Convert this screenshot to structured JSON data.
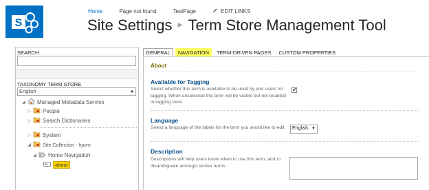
{
  "header": {
    "nav": [
      {
        "label": "Home",
        "active": true
      },
      {
        "label": "Page not found",
        "active": false
      },
      {
        "label": "TestPage",
        "active": false
      }
    ],
    "edit_links": "EDIT LINKS",
    "title_part1": "Site Settings",
    "title_separator": "▸",
    "title_part2": "Term Store Management Tool"
  },
  "left": {
    "search_label": "SEARCH",
    "search_value": "",
    "store_label": "TAXONOMY TERM STORE",
    "store_language": "English",
    "tree": {
      "root": "Managed Metadata Service",
      "people": "People",
      "search_dictionaries": "Search Dictionaries",
      "system": "System",
      "site_collection": "Site Collection - hpvm",
      "home_navigation": "Home Navigation",
      "about": "about"
    }
  },
  "tabs": [
    {
      "label": "GENERAL",
      "current": true,
      "highlight": false
    },
    {
      "label": "NAVIGATION",
      "current": false,
      "highlight": true
    },
    {
      "label": "TERM-DRIVEN PAGES",
      "current": false,
      "highlight": false
    },
    {
      "label": "CUSTOM PROPERTIES",
      "current": false,
      "highlight": false
    }
  ],
  "main": {
    "term_name": "About",
    "tagging_heading": "Available for Tagging",
    "tagging_desc": "Select whether this term is available to be used by end users for tagging. When unselected this term will be visible but not enabled in tagging tools.",
    "tagging_checked": true,
    "language_heading": "Language",
    "language_desc": "Select a language of the labels for the term you would like to edit.",
    "language_value": "English",
    "description_heading": "Description",
    "description_desc": "Descriptions will help users know when to use this term, and to disambiguate amongst similar terms.",
    "description_value": ""
  },
  "colors": {
    "brand": "#0072c6",
    "selected_node": "#ffd400",
    "tab_highlight": "#ffff60",
    "heading_blue": "#0a4f8a"
  },
  "icons": {
    "logo": "sharepoint-logo",
    "edit": "pencil-icon",
    "termstore": "home-icon",
    "group": "folder-icon",
    "termset": "tag-icon",
    "term": "term-icon"
  }
}
